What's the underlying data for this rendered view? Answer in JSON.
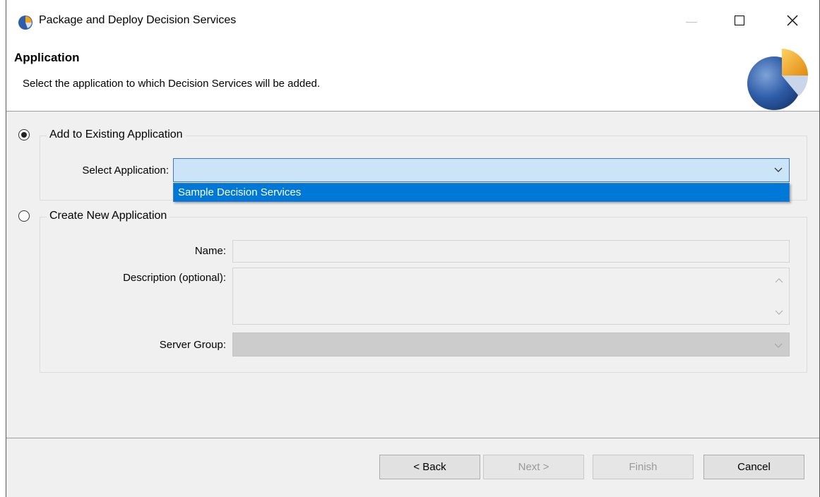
{
  "window": {
    "title": "Package and Deploy Decision Services"
  },
  "banner": {
    "title": "Application",
    "description": "Select the application to which Decision Services will be added."
  },
  "existing": {
    "label": "Add to Existing Application",
    "selected": true,
    "select_label": "Select Application:",
    "select_value": "",
    "dropdown_options": [
      "Sample Decision Services"
    ],
    "highlighted_option": "Sample Decision Services"
  },
  "create_new": {
    "label": "Create New Application",
    "selected": false,
    "name_label": "Name:",
    "name_value": "",
    "description_label": "Description (optional):",
    "description_value": "",
    "server_group_label": "Server Group:",
    "server_group_value": ""
  },
  "buttons": {
    "back": "< Back",
    "next": "Next >",
    "finish": "Finish",
    "cancel": "Cancel"
  },
  "colors": {
    "selection": "#0078d7",
    "combo_focus_bg": "#cce4f7",
    "logo_blue": "#2f5da8",
    "logo_orange": "#f0a418"
  }
}
